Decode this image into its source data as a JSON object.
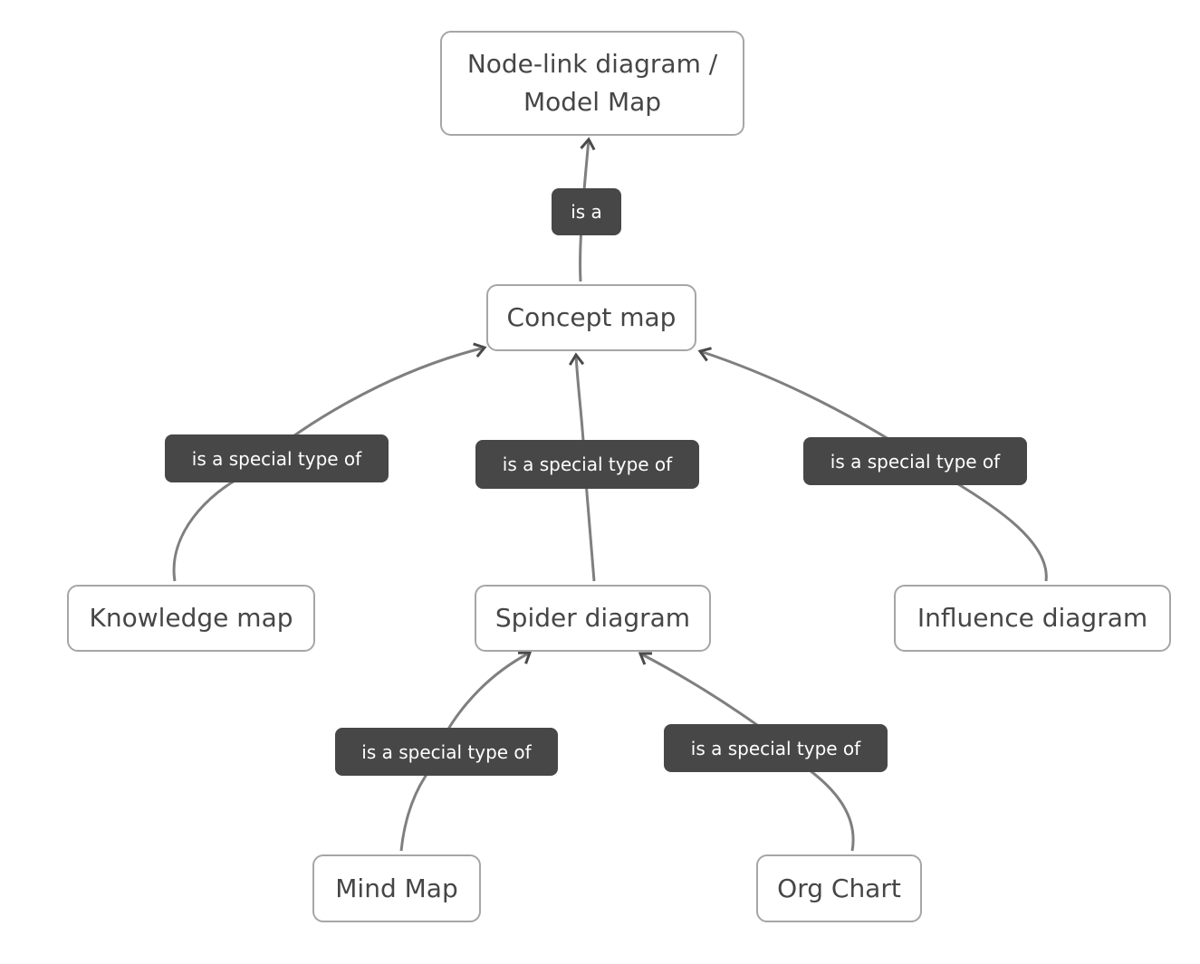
{
  "diagram": {
    "type": "concept-map",
    "colors": {
      "node_border": "#a6a6a6",
      "node_text": "#464646",
      "label_bg": "#474747",
      "label_text": "#ffffff",
      "edge": "#7f7f7f",
      "arrowhead": "#4a4a4a"
    },
    "nodes": [
      {
        "id": "node-link",
        "text": "Node-link diagram /\nModel Map"
      },
      {
        "id": "concept-map",
        "text": "Concept map"
      },
      {
        "id": "knowledge-map",
        "text": "Knowledge map"
      },
      {
        "id": "spider-diagram",
        "text": "Spider diagram"
      },
      {
        "id": "influence-diagram",
        "text": "Influence diagram"
      },
      {
        "id": "mind-map",
        "text": "Mind Map"
      },
      {
        "id": "org-chart",
        "text": "Org Chart"
      }
    ],
    "edges": [
      {
        "from": "concept-map",
        "to": "node-link",
        "label": "is a"
      },
      {
        "from": "knowledge-map",
        "to": "concept-map",
        "label": "is a special type of"
      },
      {
        "from": "spider-diagram",
        "to": "concept-map",
        "label": "is a special type of"
      },
      {
        "from": "influence-diagram",
        "to": "concept-map",
        "label": "is a special type of"
      },
      {
        "from": "mind-map",
        "to": "spider-diagram",
        "label": "is a special type of"
      },
      {
        "from": "org-chart",
        "to": "spider-diagram",
        "label": "is a special type of"
      }
    ]
  }
}
